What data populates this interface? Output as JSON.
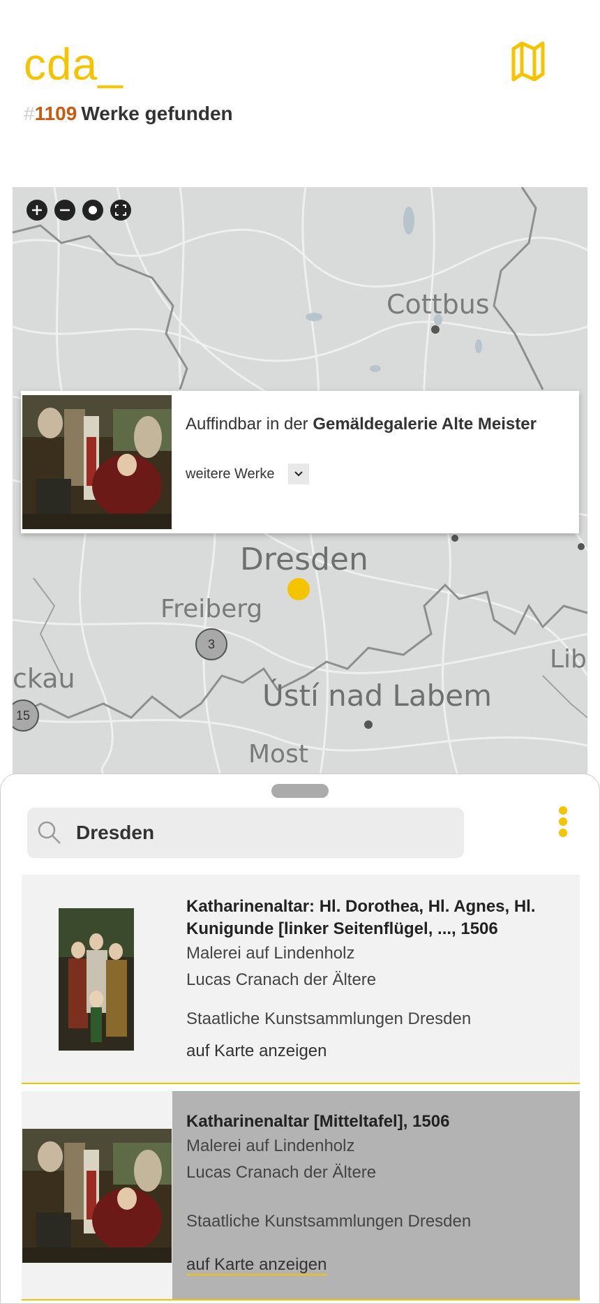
{
  "header": {
    "logo": "cda_",
    "results_hash": "#",
    "results_count": "1109",
    "results_text": "Werke gefunden",
    "map_toggle_icon": "map-icon"
  },
  "map": {
    "controls": [
      {
        "name": "zoom-in-icon"
      },
      {
        "name": "zoom-out-icon"
      },
      {
        "name": "locate-icon"
      },
      {
        "name": "fullscreen-icon"
      }
    ],
    "cities": {
      "cottbus": "Cottbus",
      "dresden": "Dresden",
      "freiberg": "Freiberg",
      "usti": "Ústí nad Labem",
      "most": "Most",
      "ckau": "ckau",
      "lib": "Lib"
    },
    "clusters": {
      "c3": "3",
      "c15": "15"
    },
    "marker_color": "#f5c400"
  },
  "popup": {
    "prefix": "Auffindbar in der",
    "museum": "Gemäldegalerie Alte Meister",
    "more_label": "weitere Werke"
  },
  "sheet": {
    "search": {
      "value": "Dresden",
      "placeholder": ""
    },
    "results": [
      {
        "title": "Katharinenaltar: Hl. Dorothea, Hl. Agnes, Hl. Kunigunde [linker Seitenflügel, ..., 1506",
        "technique": "Malerei auf Lindenholz",
        "artist": "Lucas Cranach der Ältere",
        "collection": "Staatliche Kunstsammlungen Dresden",
        "link": "auf Karte anzeigen"
      },
      {
        "title": "Katharinenaltar [Mitteltafel], 1506",
        "technique": "Malerei auf Lindenholz",
        "artist": "Lucas Cranach der Ältere",
        "collection": "Staatliche Kunstsammlungen Dresden",
        "link": "auf Karte anzeigen"
      }
    ]
  },
  "colors": {
    "accent": "#f5c400",
    "count": "#cc5a0e"
  }
}
